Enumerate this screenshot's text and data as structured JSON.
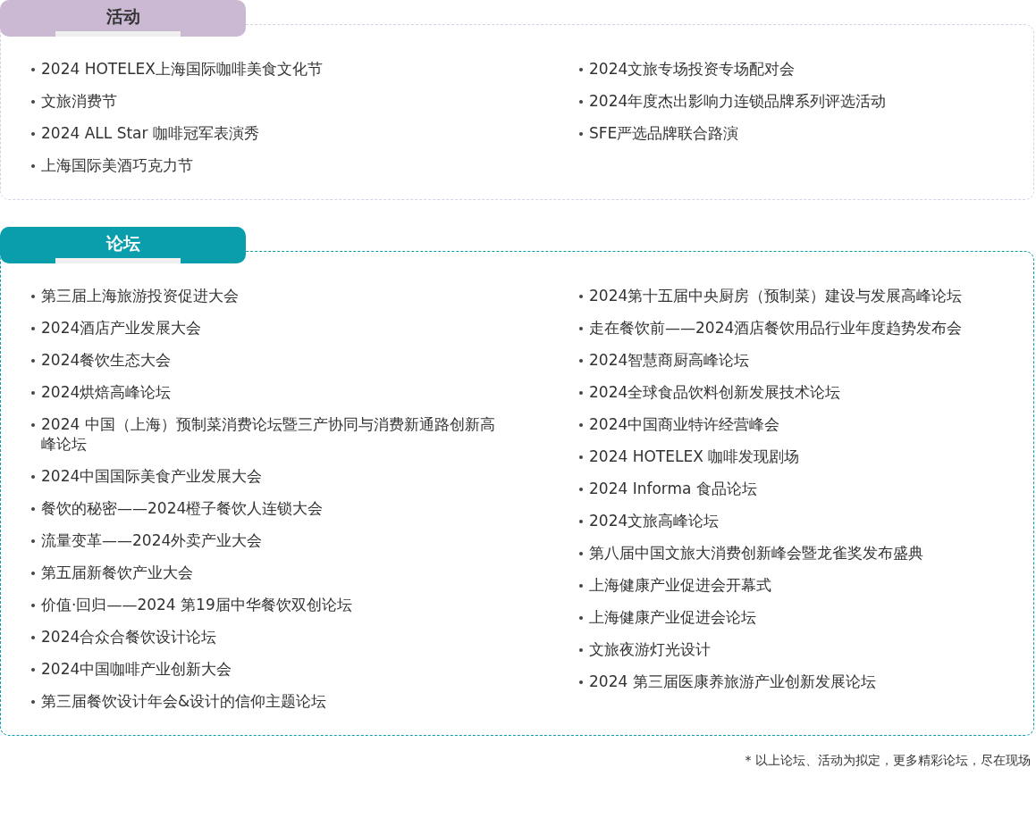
{
  "sections": [
    {
      "title": "活动",
      "color": "#cbb8d3",
      "columns": [
        [
          "2024 HOTELEX上海国际咖啡美食文化节",
          "文旅消费节",
          "2024 ALL Star 咖啡冠军表演秀",
          "上海国际美酒巧克力节"
        ],
        [
          "2024文旅专场投资专场配对会",
          "2024年度杰出影响力连锁品牌系列评选活动",
          "SFE严选品牌联合路演"
        ]
      ]
    },
    {
      "title": "论坛",
      "color": "#0a9dab",
      "columns": [
        [
          "第三届上海旅游投资促进大会",
          "2024酒店产业发展大会",
          "2024餐饮生态大会",
          "2024烘焙高峰论坛",
          "2024 中国（上海）预制菜消费论坛暨三产协同与消费新通路创新高峰论坛",
          "2024中国国际美食产业发展大会",
          "餐饮的秘密——2024橙子餐饮人连锁大会",
          "流量变革——2024外卖产业大会",
          "第五届新餐饮产业大会",
          "价值·回归——2024 第19届中华餐饮双创论坛",
          "2024合众合餐饮设计论坛",
          "2024中国咖啡产业创新大会",
          "第三届餐饮设计年会&设计的信仰主题论坛"
        ],
        [
          "2024第十五届中央厨房（预制菜）建设与发展高峰论坛",
          "走在餐饮前——2024酒店餐饮用品行业年度趋势发布会",
          "2024智慧商厨高峰论坛",
          "2024全球食品饮料创新发展技术论坛",
          "2024中国商业特许经营峰会",
          "2024 HOTELEX 咖啡发现剧场",
          "2024 Informa 食品论坛",
          "2024文旅高峰论坛",
          "第八届中国文旅大消费创新峰会暨龙雀奖发布盛典",
          "上海健康产业促进会开幕式",
          "上海健康产业促进会论坛",
          "文旅夜游灯光设计",
          "2024 第三届医康养旅游产业创新发展论坛"
        ]
      ]
    }
  ],
  "footnote": "* 以上论坛、活动为拟定，更多精彩论坛，尽在现场"
}
